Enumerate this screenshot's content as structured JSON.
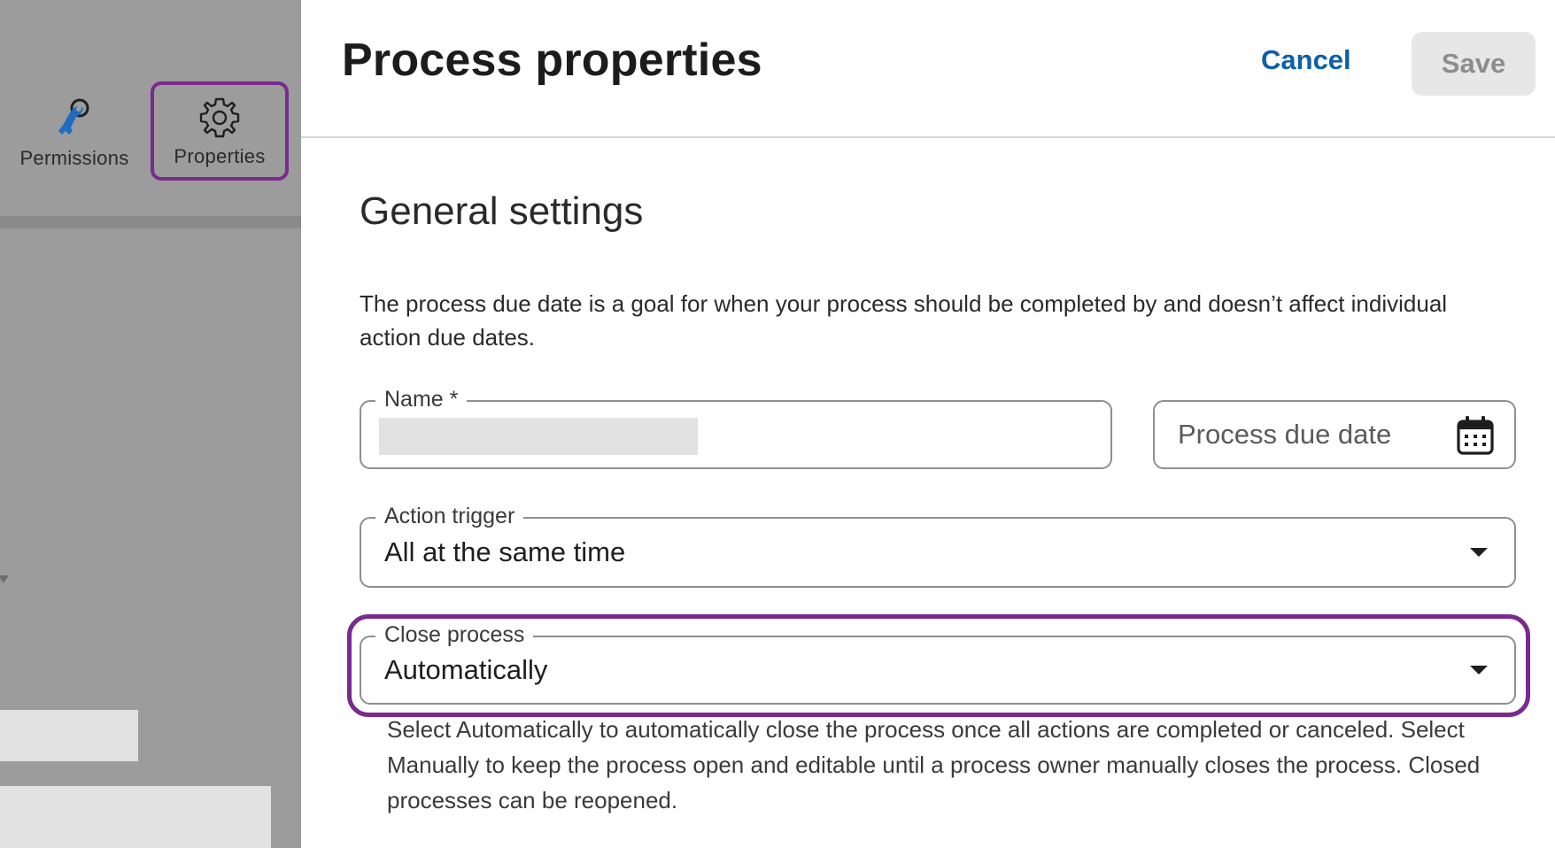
{
  "toolbar": {
    "permissions_label": "Permissions",
    "properties_label": "Properties",
    "permissions_icon": "key-icon",
    "properties_icon": "gear-icon"
  },
  "header": {
    "title": "Process properties",
    "cancel_label": "Cancel",
    "save_label": "Save"
  },
  "general": {
    "section_title": "General settings",
    "description": "The process due date is a goal for when your process should be completed by and doesn’t affect individual action due dates.",
    "name_field": {
      "label": "Name *",
      "value": ""
    },
    "due_date_field": {
      "placeholder": "Process due date",
      "icon": "calendar-icon"
    },
    "action_trigger": {
      "label": "Action trigger",
      "value": "All at the same time"
    },
    "close_process": {
      "label": "Close process",
      "value": "Automatically",
      "helper": "Select Automatically to automatically close the process once all actions are completed or canceled. Select Manually to keep the process open and editable until a process owner manually closes the process. Closed processes can be reopened."
    }
  },
  "colors": {
    "highlight": "#7a2a8e",
    "link_blue": "#0d5fa8",
    "key_icon_blue": "#1f6cc0",
    "overlay_gray": "#9c9c9c",
    "disabled_button": "#e7e7e7"
  }
}
